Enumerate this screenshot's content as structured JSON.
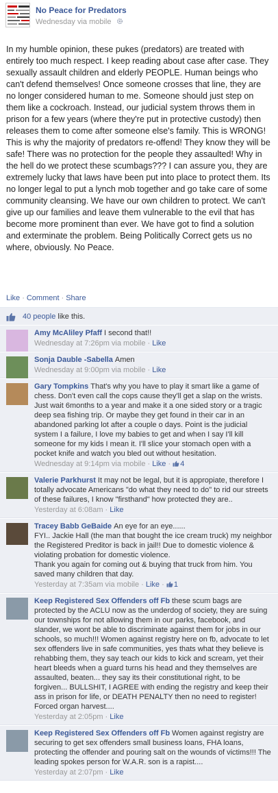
{
  "post": {
    "page_name": "No Peace for Predators",
    "meta_time": "Wednesday via mobile",
    "body": "In my humble opinion, these pukes (predators) are treated with entirely too much respect. I keep reading about case after case. They sexually assault children and elderly PEOPLE. Human beings who can't defend themselves! Once someone crosses that line, they are no longer considered human to me. Someone should just step on them like a cockroach. Instead, our judicial system throws them in prison for a few years (where they're put in protective custody) then releases them to come after someone else's family. This is WRONG! This is why the majority of predators re-offend! They know they will be safe! There was no protection for the people they assaulted! Why in the hell do we protect these scumbags??? I can assure you, they are extremely lucky that laws have been put into place to protect them. Its no longer legal to put a lynch mob together and go take care of some community cleansing. We have our own children to protect. We can't give up our families and leave them vulnerable to the evil that has become more prominent than ever. We have got to find a solution and exterminate the problem. Being Politically Correct gets us no where, obviously. No Peace.",
    "actions": {
      "like": "Like",
      "comment": "Comment",
      "share": "Share"
    },
    "likes": {
      "count_link": "40 people",
      "suffix": "like this."
    }
  },
  "comments": [
    {
      "author": "Amy McAliley Pfaff",
      "text": "I second that!!",
      "meta": "Wednesday at 7:26pm via mobile",
      "like_label": "Like",
      "like_count": "",
      "avatar_color": "#d9b7e0"
    },
    {
      "author": "Sonja Dauble -Sabella",
      "text": "Amen",
      "meta": "Wednesday at 9:00pm via mobile",
      "like_label": "Like",
      "like_count": "",
      "avatar_color": "#6d8f5a"
    },
    {
      "author": "Gary Tompkins",
      "text": "That's why you have to play it smart like a game of chess. Don't even call the cops cause they'll get a slap on the wrists. Just wait 6months to a year and make it a one sided story or a tragic deep sea fishing trip. Or maybe they get found in their car in an abandoned parking lot after a couple o days. Point is the judicial system I a failure, I love my babies to get and when I say I'll kill someone for my kids I mean it. I'll slice your stomach open with a pocket knife and watch you bled out without hesitation.",
      "meta": "Wednesday at 9:14pm via mobile",
      "like_label": "Like",
      "like_count": "4",
      "avatar_color": "#b58a5a"
    },
    {
      "author": "Valerie Parkhurst",
      "text": "It may not be legal, but it is appropiate, therefore I totally advocate Americans \"do what they need to do\" to rid our streets of these failures, I know \"firsthand\" how protected they are..",
      "meta": "Yesterday at 6:08am",
      "like_label": "Like",
      "like_count": "",
      "avatar_color": "#6a7a4a"
    },
    {
      "author": "Tracey Babb GeBaide",
      "text": "An eye for an eye......\nFYI.. Jackie Hall (the man that bought the ice cream truck) my neighbor the Registered Preditor is back in jail!! Due to domestic violence & violating probation for domestic violence.\nThank you again for coming out & buying that truck from him. You saved many children that day.",
      "meta": "Yesterday at 7:35am via mobile",
      "like_label": "Like",
      "like_count": "1",
      "avatar_color": "#5a4a3a"
    },
    {
      "author": "Keep Registered Sex Offenders off Fb",
      "text": "these scum bags are protected by the ACLU now as the underdog of society, they are suing our townships for not allowing them in our parks, facebook, and slander, we wont be able to discriminate against them for jobs in our schools, so much!!! Women against registry here on fb, advocate to let sex offenders live in safe communities, yes thats what they believe is rehabbing them, they say teach our kids to kick and scream, yet their heart bleeds when a guard turns his head and they themselves are assaulted, beaten... they say its their constitutional right, to be forgiven... BULLSHIT, I AGREE with ending the registry and keep their ass in prison for life, or DEATH PENALTY then no need to register! Forced organ harvest....",
      "meta": "Yesterday at 2:05pm",
      "like_label": "Like",
      "like_count": "",
      "avatar_color": "#8a9aa8"
    },
    {
      "author": "Keep Registered Sex Offenders off Fb",
      "text": "Women against registry are securing to get sex offenders small business loans, FHA loans, protecting the offender and pouring salt on the wounds of victims!!! The leading spokes person for W.A.R. son is a rapist....",
      "meta": "Yesterday at 2:07pm",
      "like_label": "Like",
      "like_count": "",
      "avatar_color": "#8a9aa8"
    }
  ],
  "colors": {
    "link": "#3b5998",
    "feedback_bg": "#edeff4",
    "meta": "#999999"
  }
}
